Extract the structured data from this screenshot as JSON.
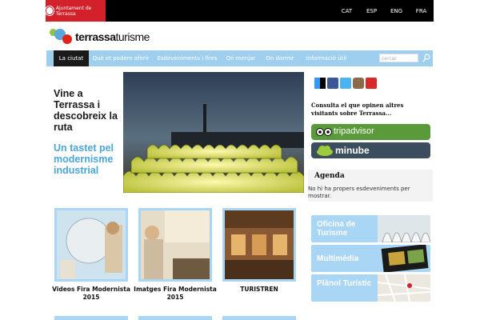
{
  "header": {
    "ajuntament_label": "Ajuntament de Terrassa",
    "languages": [
      "CAT",
      "ESP",
      "ENG",
      "FRA"
    ]
  },
  "logo": {
    "bold": "terrassa",
    "normal": "turisme"
  },
  "nav": {
    "items": [
      {
        "label": "La ciutat",
        "active": true
      },
      {
        "label": "Què et podem oferir",
        "active": false
      },
      {
        "label": "Esdeveniments i fires",
        "active": false
      },
      {
        "label": "On menjar",
        "active": false
      },
      {
        "label": "On dormir",
        "active": false
      },
      {
        "label": "Informació útil",
        "active": false
      }
    ],
    "search_placeholder": "cercar"
  },
  "hero": {
    "title": "Vine a Terrassa i descobreix la ruta",
    "subtitle": "Un tastet pel modernisme industrial"
  },
  "features": [
    {
      "caption": "Videos Fira Modernista 2015"
    },
    {
      "caption": "Imatges Fira Modernista 2015"
    },
    {
      "caption": "TURISTREN"
    }
  ],
  "sidebar": {
    "social_icons": [
      "delicious-icon",
      "facebook-icon",
      "twitter-icon",
      "instagram-icon",
      "youtube-icon"
    ],
    "consult_text": "Consulta el que opinen altres visitants sobre Terrassa...",
    "tripadvisor_label": "tripadvisor",
    "minube_label": "minube",
    "agenda_title": "Agenda",
    "agenda_text": "No hi ha propers esdeveniments per mostrar.",
    "tiles": [
      {
        "label": "Oficina de Turisme"
      },
      {
        "label": "Multimèdia"
      },
      {
        "label": "Plànol Turístic"
      }
    ]
  },
  "colors": {
    "nav_bg": "#9fcfef",
    "accent_red": "#d3212b",
    "tile_bg": "#a8d6f4",
    "tripadvisor_green": "#5b9a3a",
    "minube_dark": "#3c4e5e"
  }
}
